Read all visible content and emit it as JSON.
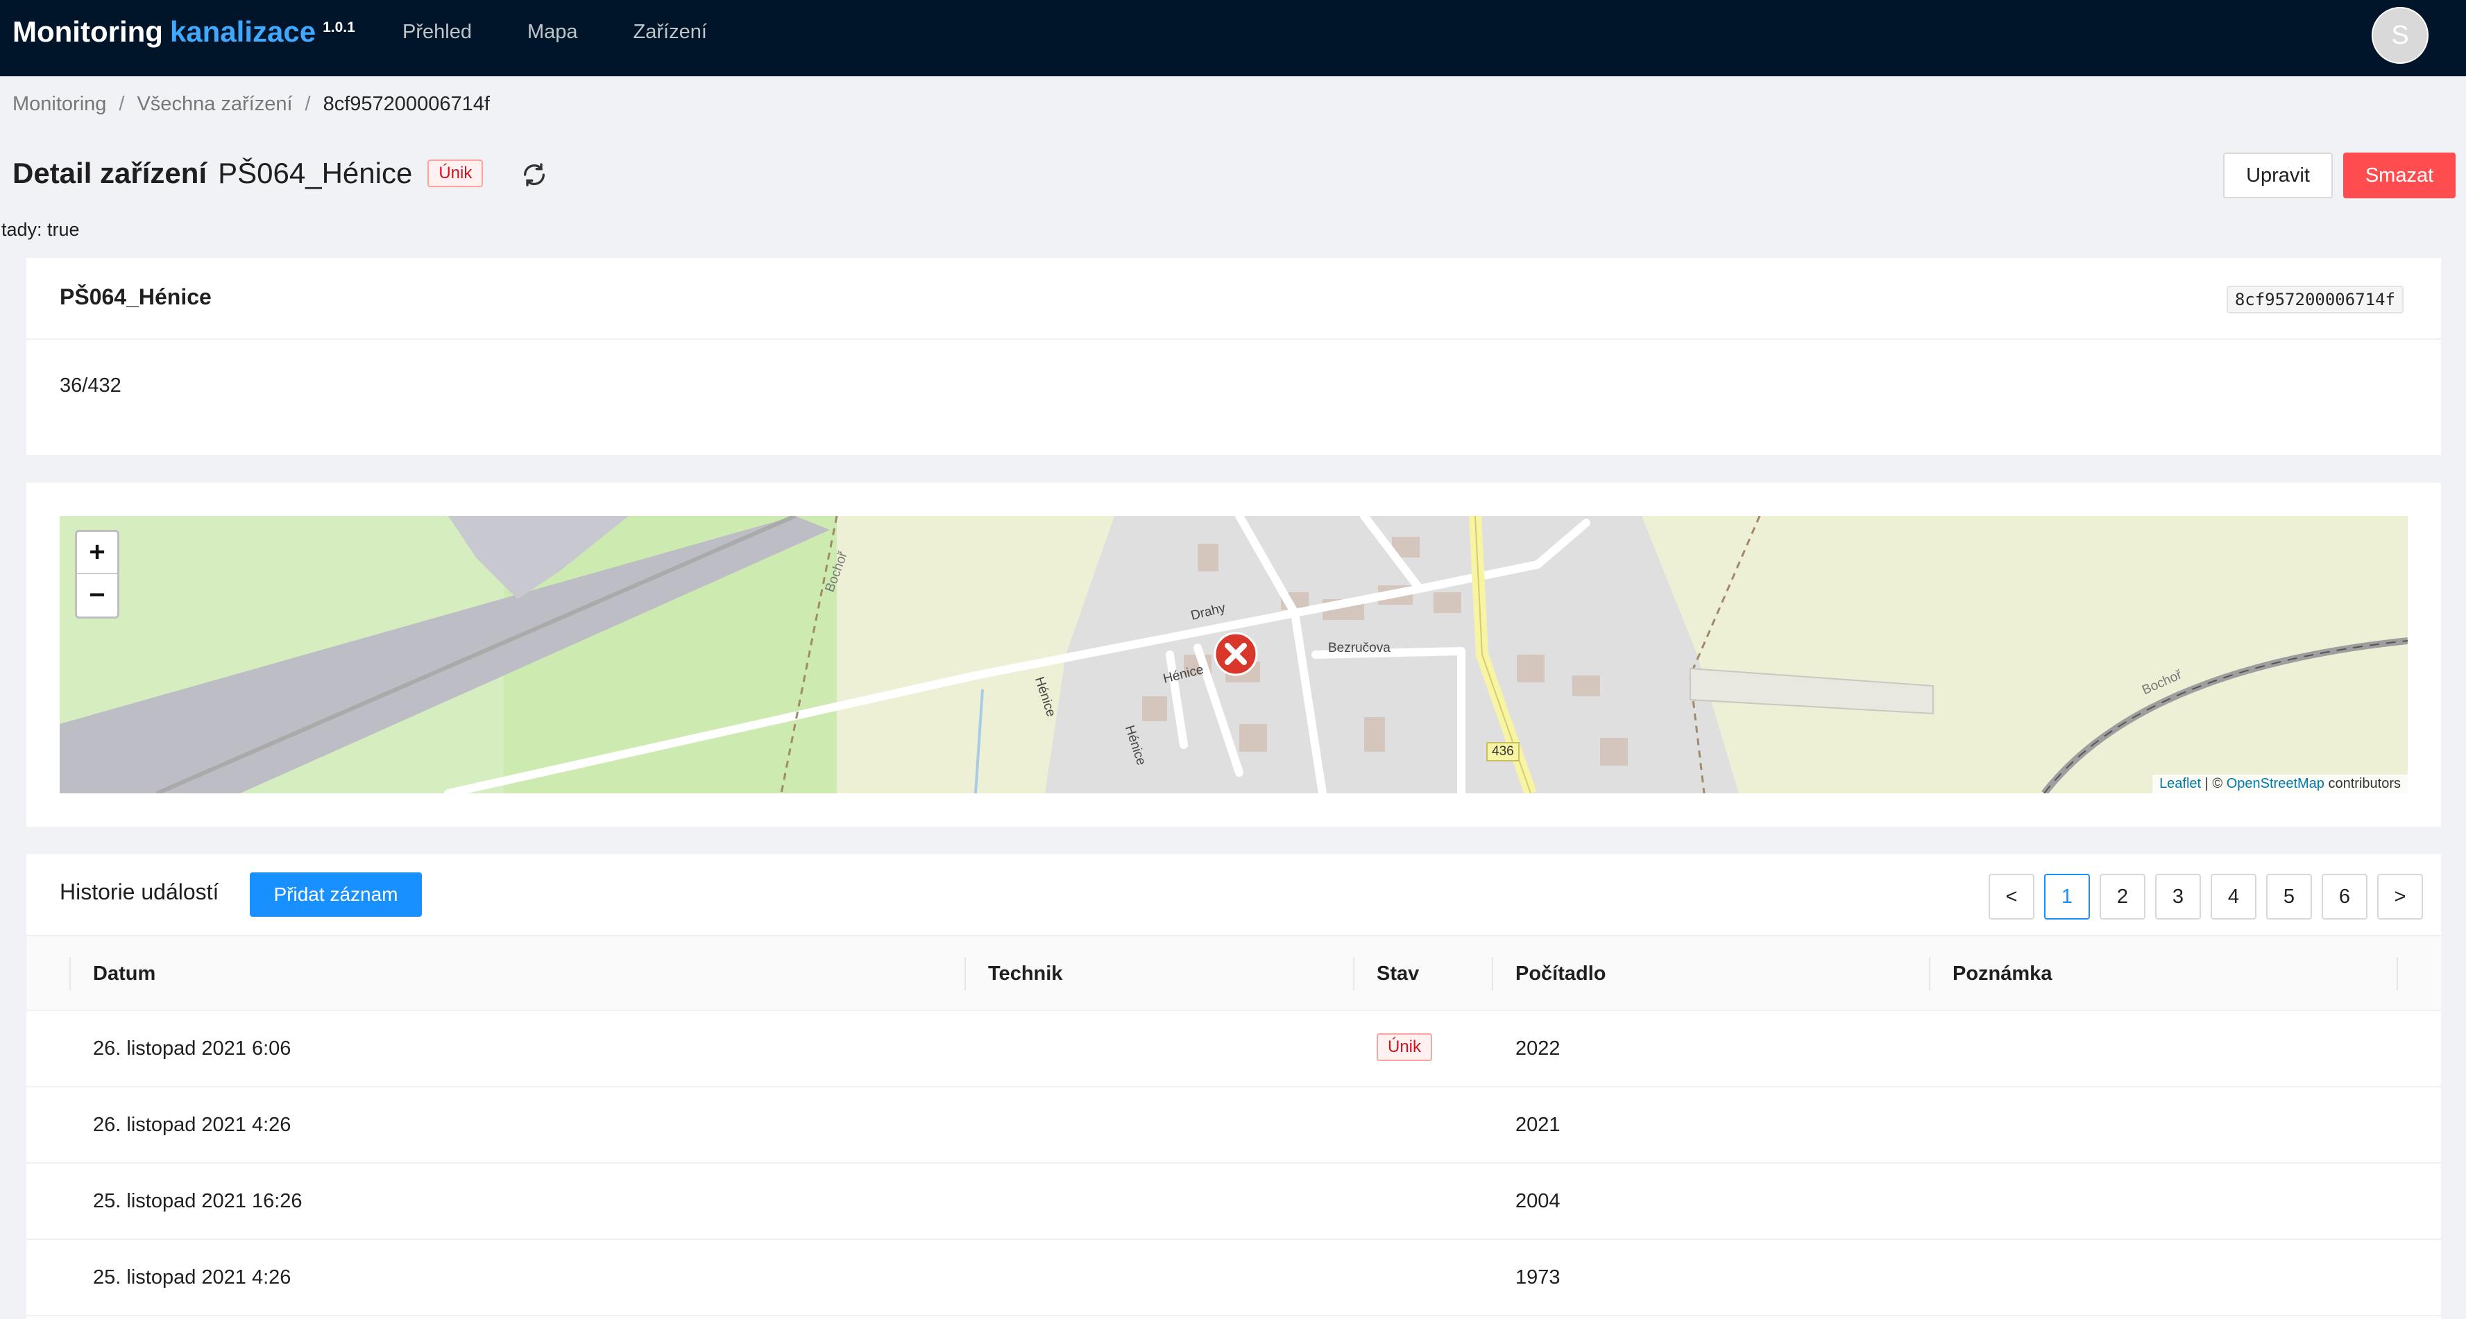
{
  "header": {
    "brand_main": "Monitoring",
    "brand_accent": "kanalizace",
    "version": "1.0.1",
    "nav": [
      "Přehled",
      "Mapa",
      "Zařízení"
    ],
    "avatar_initial": "S"
  },
  "breadcrumb": {
    "items": [
      "Monitoring",
      "Všechna zařízení"
    ],
    "separator": "/",
    "current": "8cf957200006714f"
  },
  "page": {
    "title": "Detail zařízení",
    "device_name": "PŠ064_Hénice",
    "status_tag": "Únik",
    "edit_label": "Upravit",
    "delete_label": "Smazat",
    "debug_text": "tady: true"
  },
  "device_card": {
    "name": "PŠ064_Hénice",
    "device_id": "8cf957200006714f",
    "description": "36/432"
  },
  "map": {
    "zoom_in": "+",
    "zoom_out": "−",
    "street_labels": [
      "Drahy",
      "Hénice",
      "Bezručova",
      "Hénice",
      "Hénice",
      "Bochoř",
      "Bochoř"
    ],
    "road_number": "436",
    "attribution_leaflet": "Leaflet",
    "attribution_sep": " | © ",
    "attribution_osm": "OpenStreetMap",
    "attribution_tail": " contributors",
    "marker_status_color": "#d9372a"
  },
  "history": {
    "title": "Historie událostí",
    "add_label": "Přidat záznam",
    "pagination": {
      "prev": "<",
      "next": ">",
      "pages": [
        "1",
        "2",
        "3",
        "4",
        "5",
        "6"
      ],
      "current": "1"
    },
    "columns": [
      "Datum",
      "Technik",
      "Stav",
      "Počítadlo",
      "Poznámka"
    ],
    "rows": [
      {
        "datum": "26. listopad 2021 6:06",
        "technik": "",
        "stav": "Únik",
        "pocitadlo": "2022",
        "poznamka": ""
      },
      {
        "datum": "26. listopad 2021 4:26",
        "technik": "",
        "stav": "",
        "pocitadlo": "2021",
        "poznamka": ""
      },
      {
        "datum": "25. listopad 2021 16:26",
        "technik": "",
        "stav": "",
        "pocitadlo": "2004",
        "poznamka": ""
      },
      {
        "datum": "25. listopad 2021 4:26",
        "technik": "",
        "stav": "",
        "pocitadlo": "1973",
        "poznamka": ""
      }
    ]
  }
}
